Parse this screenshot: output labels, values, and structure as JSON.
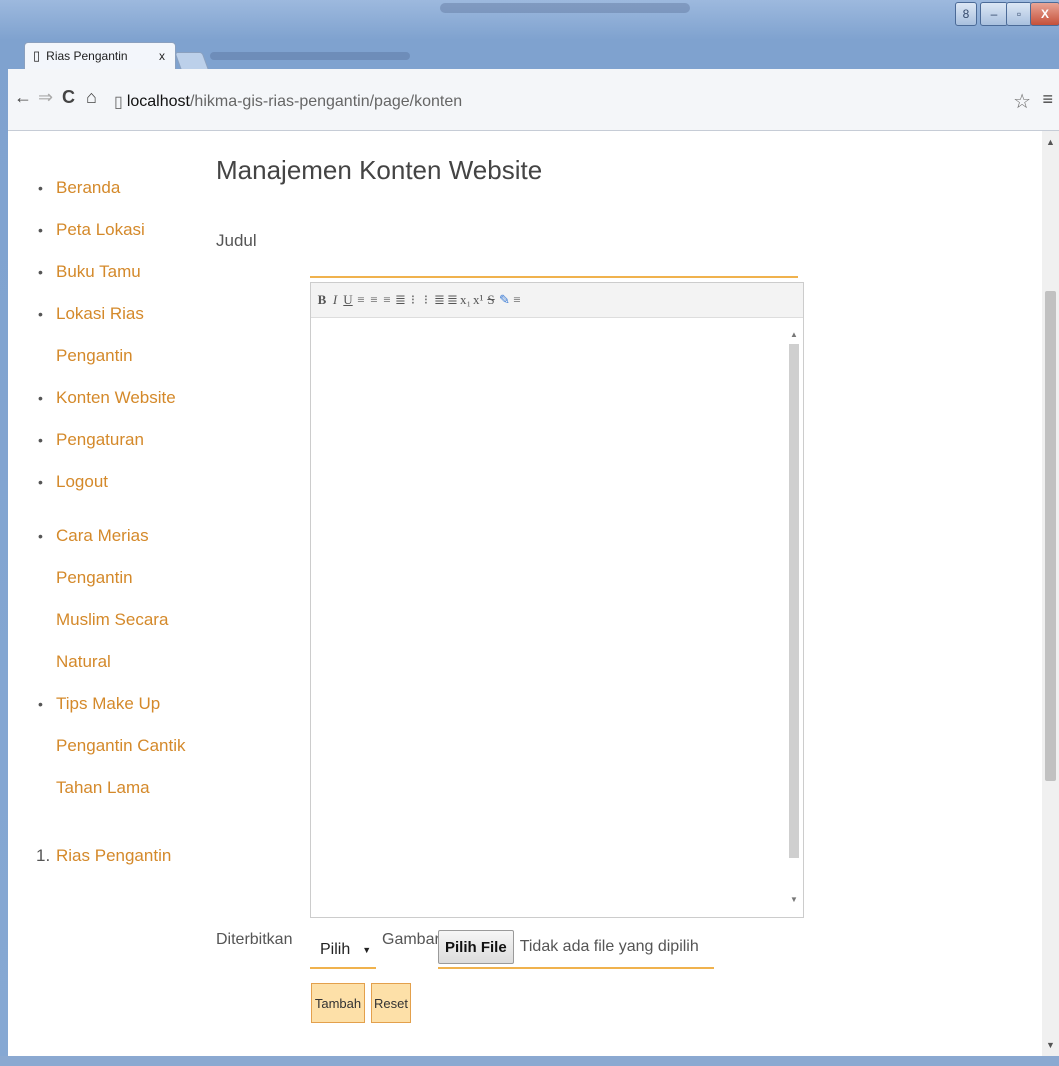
{
  "browser": {
    "tab_title": "Rias Pengantin",
    "tab_close": "x",
    "url_host": "localhost",
    "url_path": "/hikma-gis-rias-pengantin/page/konten",
    "window_controls": [
      "8",
      "–",
      "▫",
      "X"
    ]
  },
  "sidebar": {
    "menu": [
      "Beranda",
      "Peta Lokasi",
      "Buku Tamu",
      "Lokasi Rias Pengantin",
      "Konten Website",
      "Pengaturan",
      "Logout"
    ],
    "posts": [
      "Cara Merias Pengantin",
      "Muslim Secara Natural",
      "Tips Make Up",
      "Pengantin Cantik",
      "Tahan Lama"
    ],
    "numbered": [
      "Rias Pengantin"
    ]
  },
  "main": {
    "title": "Manajemen Konten Website",
    "judul_label": "Judul",
    "diterbitkan_label": "Diterbitkan",
    "select_value": "Pilih",
    "gambar_label": "Gambar",
    "file_button": "Pilih File",
    "file_status": "Tidak ada file yang dipilih",
    "tambah_label": "Tambah",
    "reset_label": "Reset"
  },
  "editor_toolbar": [
    "B",
    "I",
    "U",
    "align-left-icon",
    "align-center-icon",
    "align-right-icon",
    "justify-icon",
    "ordered-list-icon",
    "unordered-list-icon",
    "outdent-icon",
    "indent-icon",
    "subscript-icon",
    "superscript-icon",
    "strikethrough-icon",
    "remove-format-icon",
    "html-icon"
  ],
  "colors": {
    "accent": "#d4892a",
    "underline": "#f0b24d",
    "button_bg": "#fde0a8"
  }
}
